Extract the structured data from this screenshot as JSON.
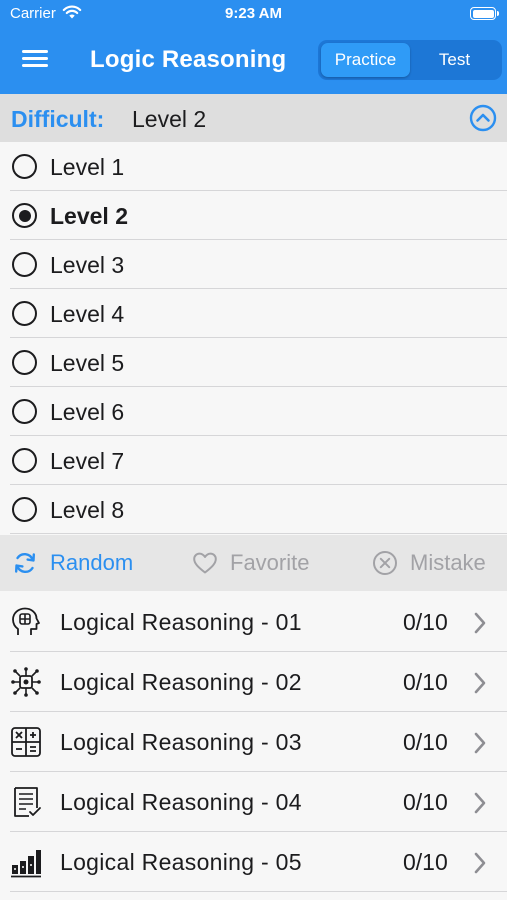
{
  "status": {
    "carrier": "Carrier",
    "time": "9:23 AM"
  },
  "nav": {
    "title": "Logic Reasoning",
    "segments": [
      "Practice",
      "Test"
    ],
    "active_segment": "Practice"
  },
  "difficulty": {
    "label": "Difficult:",
    "value": "Level 2"
  },
  "levels": [
    {
      "label": "Level 1",
      "selected": false
    },
    {
      "label": "Level 2",
      "selected": true
    },
    {
      "label": "Level 3",
      "selected": false
    },
    {
      "label": "Level 4",
      "selected": false
    },
    {
      "label": "Level 5",
      "selected": false
    },
    {
      "label": "Level 6",
      "selected": false
    },
    {
      "label": "Level 7",
      "selected": false
    },
    {
      "label": "Level 8",
      "selected": false
    }
  ],
  "filters": [
    {
      "label": "Random",
      "icon": "refresh-icon",
      "active": true
    },
    {
      "label": "Favorite",
      "icon": "heart-icon",
      "active": false
    },
    {
      "label": "Mistake",
      "icon": "x-circle-icon",
      "active": false
    }
  ],
  "quizzes": [
    {
      "title": "Logical Reasoning - 01",
      "score": "0/10",
      "icon": "brain-head-icon"
    },
    {
      "title": "Logical Reasoning - 02",
      "score": "0/10",
      "icon": "network-chip-icon"
    },
    {
      "title": "Logical Reasoning - 03",
      "score": "0/10",
      "icon": "calculator-icon"
    },
    {
      "title": "Logical Reasoning - 04",
      "score": "0/10",
      "icon": "checklist-icon"
    },
    {
      "title": "Logical Reasoning - 05",
      "score": "0/10",
      "icon": "bar-chart-icon"
    }
  ],
  "colors": {
    "accent": "#2b8ff0",
    "header_bg": "#dedede",
    "muted": "#a2a2a6"
  }
}
